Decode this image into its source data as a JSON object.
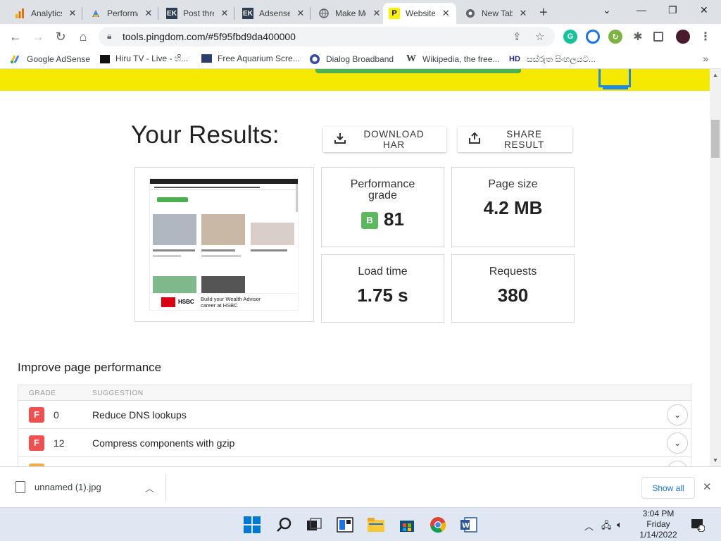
{
  "browser": {
    "tabs": [
      {
        "title": "Analytics",
        "icon": "bar-chart-icon",
        "active": false
      },
      {
        "title": "Performance",
        "icon": "gauge-icon",
        "active": false
      },
      {
        "title": "Post thread",
        "icon": "ek-icon",
        "active": false
      },
      {
        "title": "Adsense",
        "icon": "ek-icon",
        "active": false
      },
      {
        "title": "Make Money",
        "icon": "globe-icon",
        "active": false
      },
      {
        "title": "Website",
        "icon": "pingdom-icon",
        "active": true
      },
      {
        "title": "New Tab",
        "icon": "chrome-icon",
        "active": false
      }
    ],
    "url": "tools.pingdom.com/#5f95fbd9da400000",
    "bookmarks": [
      {
        "label": "Google AdSense"
      },
      {
        "label": "Hiru TV - Live - හි..."
      },
      {
        "label": "Free Aquarium Scre..."
      },
      {
        "label": "Dialog Broadband"
      },
      {
        "label": "Wikipedia, the free..."
      },
      {
        "label": "සස්රුත සිංහලයට..."
      }
    ],
    "bookmark_icons": {
      "hd": "HD",
      "wiki": "W"
    }
  },
  "results": {
    "title": "Your Results:",
    "download_label": "DOWNLOAD HAR",
    "share_label": "SHARE RESULT",
    "performance_grade_label": "Performance grade",
    "grade_letter": "B",
    "grade_value": "81",
    "page_size_label": "Page size",
    "page_size_value": "4.2 MB",
    "load_time_label": "Load time",
    "load_time_value": "1.75 s",
    "requests_label": "Requests",
    "requests_value": "380",
    "thumbnail": {
      "ad_brand": "HSBC",
      "ad_text_1": "Build your Wealth Advisor",
      "ad_text_2": "career at HSBC"
    }
  },
  "improve": {
    "title": "Improve page performance",
    "col_grade": "GRADE",
    "col_suggestion": "SUGGESTION",
    "rows": [
      {
        "grade": "F",
        "score": "0",
        "suggestion": "Reduce DNS lookups"
      },
      {
        "grade": "F",
        "score": "12",
        "suggestion": "Compress components with gzip"
      }
    ]
  },
  "downloads": {
    "file_name": "unnamed (1).jpg",
    "show_all": "Show all"
  },
  "taskbar": {
    "time": "3:04 PM",
    "day": "Friday",
    "date": "1/14/2022",
    "notif_count": "1"
  },
  "colors": {
    "banner_yellow": "#f5e901",
    "grade_green": "#5cb85c",
    "grade_red": "#f05050",
    "grade_orange": "#f0ad4e"
  }
}
